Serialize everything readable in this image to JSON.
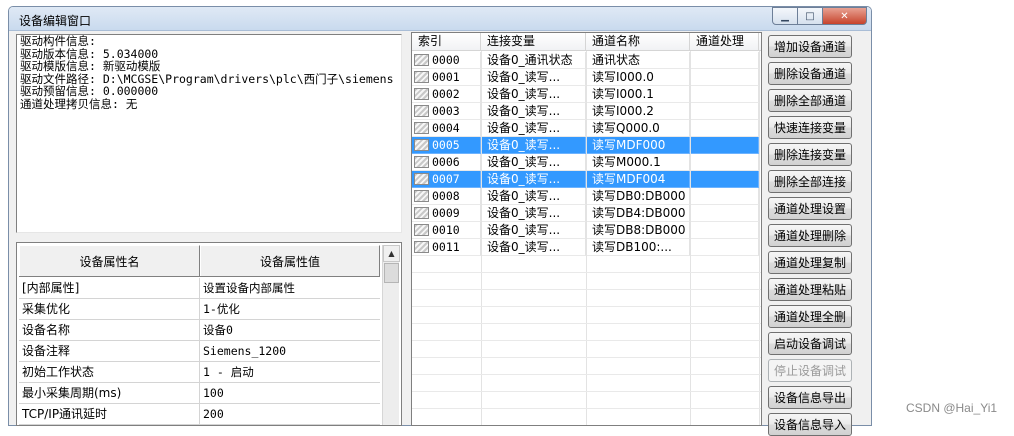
{
  "window": {
    "title": "设备编辑窗口",
    "buttons": {
      "minimize": "▁",
      "maximize": "□",
      "close": "✕"
    }
  },
  "driver_info": {
    "lines": [
      "驱动构件信息:",
      "驱动版本信息: 5.034000",
      "驱动模版信息: 新驱动模版",
      "驱动文件路径: D:\\MCGSE\\Program\\drivers\\plc\\西门子\\siemens",
      "驱动预留信息: 0.000000",
      "通道处理拷贝信息: 无"
    ]
  },
  "properties": {
    "headers": {
      "name": "设备属性名",
      "value": "设备属性值"
    },
    "rows": [
      {
        "name": "[内部属性]",
        "value": "设置设备内部属性"
      },
      {
        "name": "采集优化",
        "value": "1-优化"
      },
      {
        "name": "设备名称",
        "value": "设备0"
      },
      {
        "name": "设备注释",
        "value": "Siemens_1200"
      },
      {
        "name": "初始工作状态",
        "value": "1 - 启动"
      },
      {
        "name": "最小采集周期(ms)",
        "value": "100"
      },
      {
        "name": "TCP/IP通讯延时",
        "value": "200"
      }
    ]
  },
  "channels": {
    "headers": {
      "index": "索引",
      "variable": "连接变量",
      "name": "通道名称",
      "processing": "通道处理"
    },
    "rows": [
      {
        "index": "0000",
        "variable": "设备0_通讯状态",
        "name": "通讯状态",
        "processing": "",
        "selected": false
      },
      {
        "index": "0001",
        "variable": "设备0_读写...",
        "name": "读写I000.0",
        "processing": "",
        "selected": false
      },
      {
        "index": "0002",
        "variable": "设备0_读写...",
        "name": "读写I000.1",
        "processing": "",
        "selected": false
      },
      {
        "index": "0003",
        "variable": "设备0_读写...",
        "name": "读写I000.2",
        "processing": "",
        "selected": false
      },
      {
        "index": "0004",
        "variable": "设备0_读写...",
        "name": "读写Q000.0",
        "processing": "",
        "selected": false
      },
      {
        "index": "0005",
        "variable": "设备0_读写...",
        "name": "读写MDF000",
        "processing": "",
        "selected": true
      },
      {
        "index": "0006",
        "variable": "设备0_读写...",
        "name": "读写M000.1",
        "processing": "",
        "selected": false
      },
      {
        "index": "0007",
        "variable": "设备0_读写...",
        "name": "读写MDF004",
        "processing": "",
        "selected": true
      },
      {
        "index": "0008",
        "variable": "设备0_读写...",
        "name": "读写DB0:DB000",
        "processing": "",
        "selected": false
      },
      {
        "index": "0009",
        "variable": "设备0_读写...",
        "name": "读写DB4:DB000",
        "processing": "",
        "selected": false
      },
      {
        "index": "0010",
        "variable": "设备0_读写...",
        "name": "读写DB8:DB000",
        "processing": "",
        "selected": false
      },
      {
        "index": "0011",
        "variable": "设备0_读写...",
        "name": "读写DB100:...",
        "processing": "",
        "selected": false
      }
    ]
  },
  "actions": [
    {
      "label": "增加设备通道",
      "enabled": true
    },
    {
      "label": "删除设备通道",
      "enabled": true
    },
    {
      "label": "删除全部通道",
      "enabled": true
    },
    {
      "label": "快速连接变量",
      "enabled": true
    },
    {
      "label": "删除连接变量",
      "enabled": true
    },
    {
      "label": "删除全部连接",
      "enabled": true
    },
    {
      "label": "通道处理设置",
      "enabled": true
    },
    {
      "label": "通道处理删除",
      "enabled": true
    },
    {
      "label": "通道处理复制",
      "enabled": true
    },
    {
      "label": "通道处理粘贴",
      "enabled": true
    },
    {
      "label": "通道处理全删",
      "enabled": true
    },
    {
      "label": "启动设备调试",
      "enabled": true
    },
    {
      "label": "停止设备调试",
      "enabled": false
    },
    {
      "label": "设备信息导出",
      "enabled": true
    },
    {
      "label": "设备信息导入",
      "enabled": true
    }
  ],
  "watermark": "CSDN @Hai_Yi1",
  "colors": {
    "selection": "#3399ff",
    "title_bar": "#c9daee",
    "close_button": "#c7432c"
  }
}
